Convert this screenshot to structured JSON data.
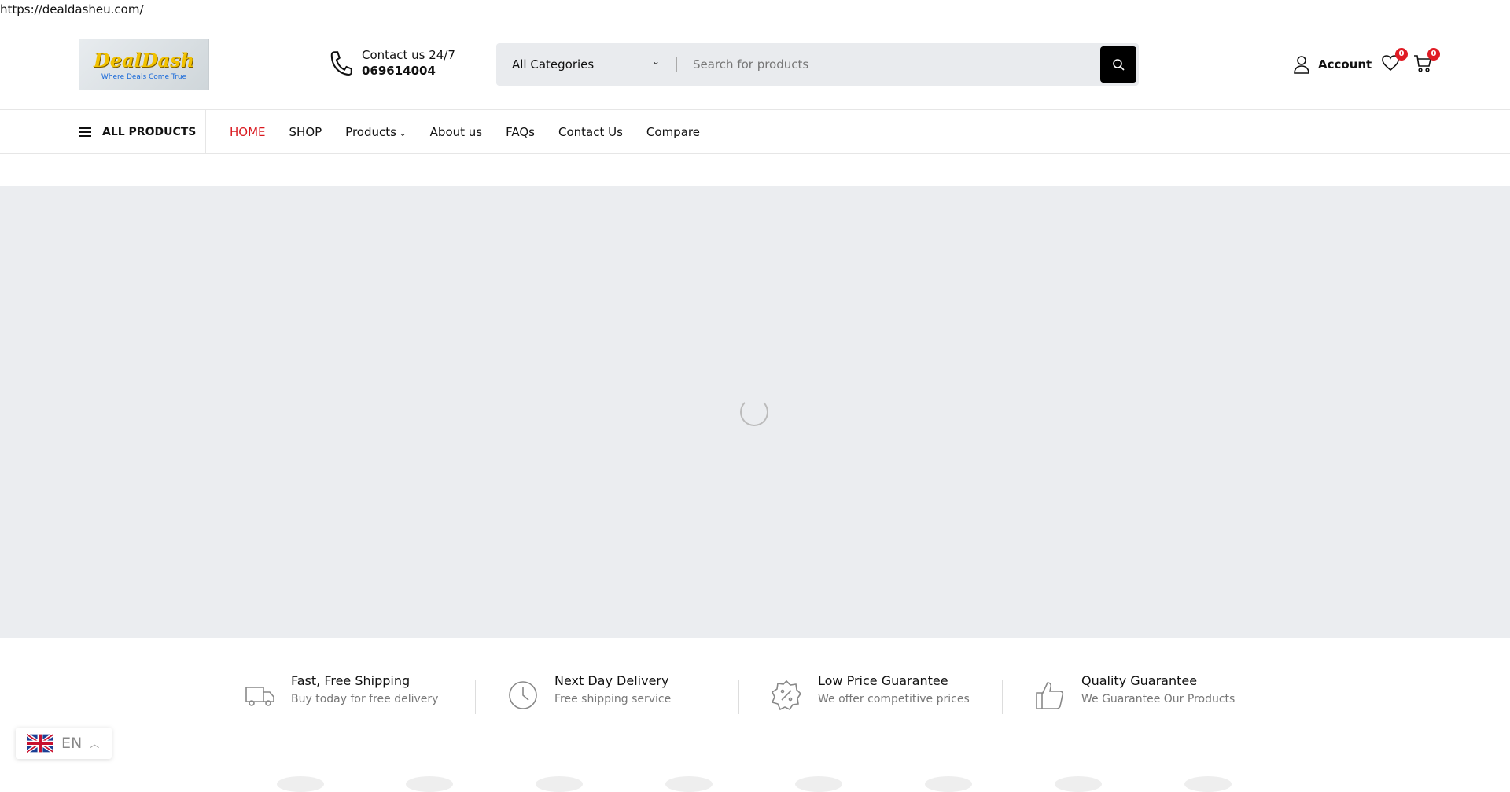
{
  "url": "https://dealdasheu.com/",
  "logo": {
    "brand": "DealDash",
    "tagline": "Where Deals Come True"
  },
  "contact": {
    "label": "Contact us 24/7",
    "phone": "069614004"
  },
  "search": {
    "category": "All Categories",
    "placeholder": "Search for products"
  },
  "account": {
    "label": "Account"
  },
  "wishlist": {
    "count": "0"
  },
  "cart": {
    "count": "0"
  },
  "nav": {
    "all_products": "ALL PRODUCTS",
    "items": [
      {
        "label": "HOME"
      },
      {
        "label": "SHOP"
      },
      {
        "label": "Products"
      },
      {
        "label": "About us"
      },
      {
        "label": "FAQs"
      },
      {
        "label": "Contact Us"
      },
      {
        "label": "Compare"
      }
    ]
  },
  "features": [
    {
      "title": "Fast, Free Shipping",
      "subtitle": "Buy today for free delivery",
      "icon": "truck-icon"
    },
    {
      "title": "Next Day Delivery",
      "subtitle": "Free shipping service",
      "icon": "clock-icon"
    },
    {
      "title": "Low Price Guarantee",
      "subtitle": "We offer competitive prices",
      "icon": "discount-icon"
    },
    {
      "title": "Quality Guarantee",
      "subtitle": "We Guarantee Our Products",
      "icon": "thumbs-up-icon"
    }
  ],
  "language": {
    "code": "EN"
  },
  "colors": {
    "accent": "#d9191f",
    "badge": "#e01b24",
    "hero_bg": "#ebedf0"
  }
}
